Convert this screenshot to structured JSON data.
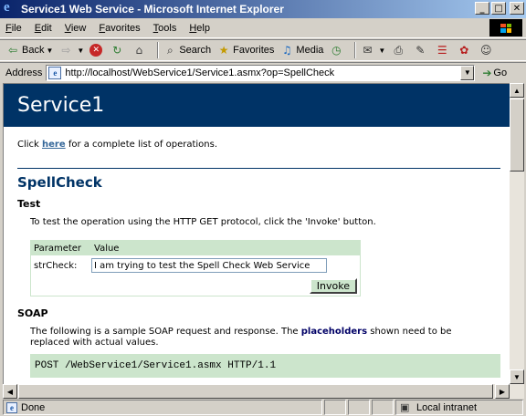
{
  "window": {
    "title": "Service1 Web Service - Microsoft Internet Explorer"
  },
  "menu": [
    {
      "accel": "F",
      "rest": "ile"
    },
    {
      "accel": "E",
      "rest": "dit"
    },
    {
      "accel": "V",
      "rest": "iew"
    },
    {
      "accel": "F",
      "rest": "avorites"
    },
    {
      "accel": "T",
      "rest": "ools"
    },
    {
      "accel": "H",
      "rest": "elp"
    }
  ],
  "toolbar": {
    "back": "Back",
    "search": "Search",
    "favorites": "Favorites",
    "media": "Media"
  },
  "address": {
    "label": "Address",
    "url": "http://localhost/WebService1/Service1.asmx?op=SpellCheck",
    "go": "Go"
  },
  "page": {
    "service_name": "Service1",
    "intro_before": "Click ",
    "intro_link": "here",
    "intro_after": " for a complete list of operations.",
    "operation": "SpellCheck",
    "test": {
      "heading": "Test",
      "text": "To test the operation using the HTTP GET protocol, click the 'Invoke' button.",
      "col_parameter": "Parameter",
      "col_value": "Value",
      "param_name": "strCheck:",
      "param_value": "I am trying to test the Spell Check Web Service",
      "invoke": "Invoke"
    },
    "soap": {
      "heading": "SOAP",
      "text_before": "The following is a sample SOAP request and response. The ",
      "placeholders": "placeholders",
      "text_after": " shown need to be replaced with actual values.",
      "code": "POST /WebService1/Service1.asmx HTTP/1.1"
    }
  },
  "status": {
    "text": "Done",
    "zone": "Local intranet"
  }
}
